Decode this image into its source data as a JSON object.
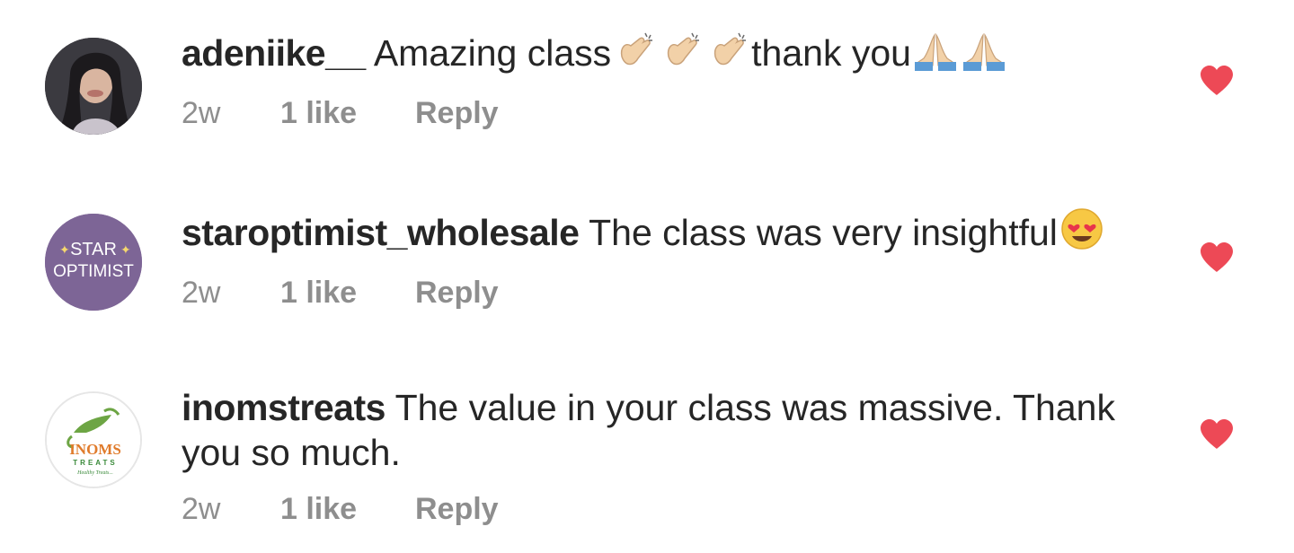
{
  "comments": [
    {
      "username": "adeniike__",
      "text": "Amazing class",
      "text_after": "thank you",
      "emojis_mid": [
        "clapping-hands",
        "clapping-hands",
        "clapping-hands"
      ],
      "emojis_end": [
        "folded-hands",
        "folded-hands"
      ],
      "time": "2w",
      "likes": "1 like",
      "reply": "Reply",
      "liked": true
    },
    {
      "username": "staroptimist_wholesale",
      "text": "The class was very insightful",
      "emojis_end": [
        "heart-eyes"
      ],
      "avatar_text_top": "STAR",
      "avatar_text_bottom": "OPTIMIST",
      "time": "2w",
      "likes": "1 like",
      "reply": "Reply",
      "liked": true
    },
    {
      "username": "inomstreats",
      "text": "The value in your class was massive. Thank you so much.",
      "avatar_text_top": "INOMS",
      "avatar_text_mid": "TREATS",
      "avatar_text_bottom": "Healthy Treats...",
      "time": "2w",
      "likes": "1 like",
      "reply": "Reply",
      "liked": true
    }
  ],
  "colors": {
    "heart": "#ed4956",
    "meta": "#8e8e8e",
    "text": "#262626",
    "star_avatar_bg": "#7d6596"
  }
}
